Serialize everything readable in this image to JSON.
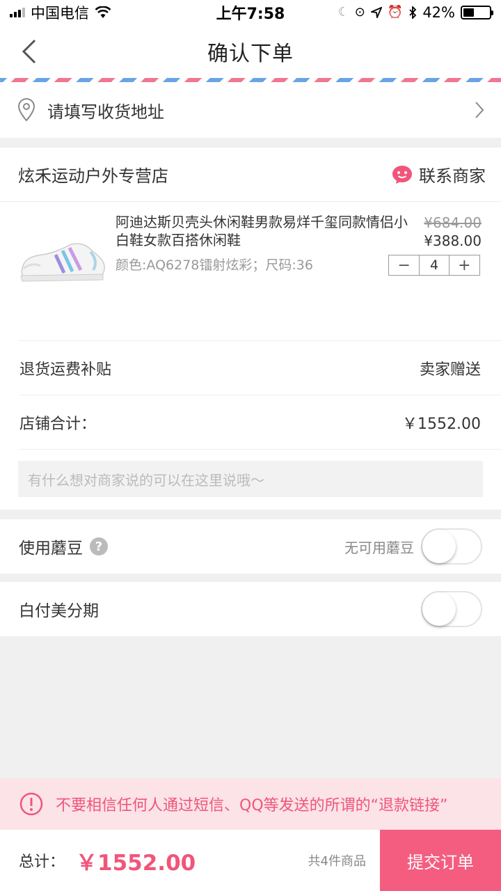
{
  "status_bar": {
    "carrier": "中国电信",
    "time": "上午7:58",
    "battery": "42%",
    "battery_level": 0.42
  },
  "nav": {
    "title": "确认下单"
  },
  "address": {
    "placeholder": "请填写收货地址"
  },
  "shop": {
    "name": "炫禾运动户外专营店",
    "contact_label": "联系商家",
    "product": {
      "title": "阿迪达斯贝壳头休闲鞋男款易烊千玺同款情侣小白鞋女款百搭休闲鞋",
      "spec": "颜色:AQ6278镭射炫彩；尺码:36",
      "original_price": "¥684.00",
      "price": "¥388.00",
      "quantity": "4",
      "decrement": "−",
      "increment": "+"
    },
    "return_shipping_label": "退货运费补贴",
    "return_shipping_value": "卖家赠送",
    "subtotal_label": "店铺合计：",
    "subtotal_value": "￥1552.00",
    "note_placeholder": "有什么想对商家说的可以在这里说哦～"
  },
  "mogu_beans": {
    "label": "使用蘑豆",
    "help": "?",
    "status": "无可用蘑豆",
    "enabled": false
  },
  "installment": {
    "label": "白付美分期",
    "enabled": false
  },
  "warning": {
    "text": "不要相信任何人通过短信、QQ等发送的所谓的“退款链接”"
  },
  "footer": {
    "total_label": "总计：",
    "total_value": "￥1552.00",
    "item_count": "共4件商品",
    "submit_label": "提交订单"
  },
  "colors": {
    "accent": "#f45d80",
    "accent_text": "#f0557a",
    "warning_bg": "#fbe3e8"
  }
}
